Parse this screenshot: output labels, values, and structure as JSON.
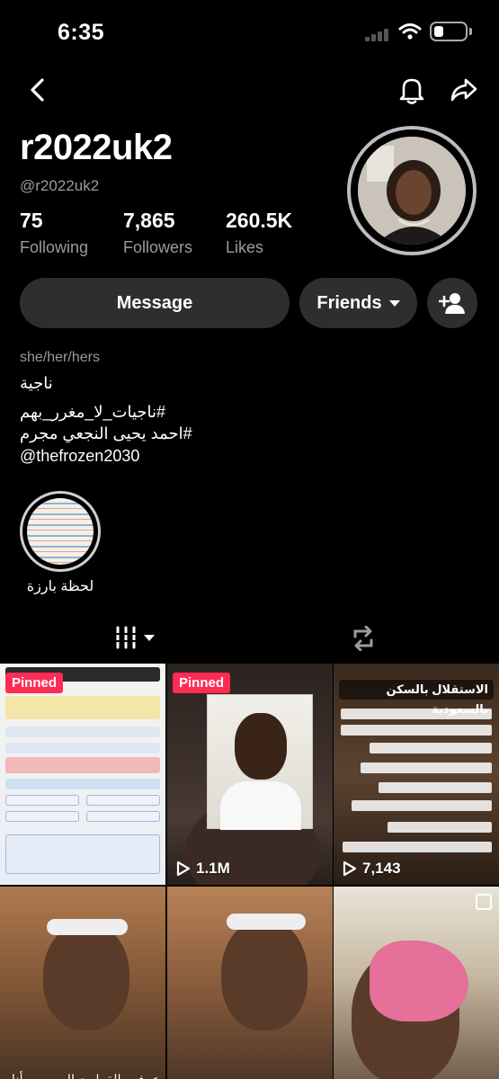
{
  "status_bar": {
    "time": "6:35"
  },
  "profile": {
    "username": "r2022uk2",
    "handle": "@r2022uk2",
    "stats": [
      {
        "value": "75",
        "label": "Following"
      },
      {
        "value": "7,865",
        "label": "Followers"
      },
      {
        "value": "260.5K",
        "label": "Likes"
      }
    ],
    "pronouns": "she/her/hers",
    "bio": [
      "ناجية",
      "#ناجيات_لا_مغرر_بهم",
      "#احمد يحيى النجعي مجرم",
      "@thefrozen2030"
    ]
  },
  "actions": {
    "message": "Message",
    "friends": "Friends"
  },
  "highlight": {
    "label": "لحظة بارزة"
  },
  "grid": {
    "tiles": [
      {
        "pinned": "Pinned",
        "views": ""
      },
      {
        "pinned": "Pinned",
        "views": "1.1M"
      },
      {
        "pinned": "",
        "views": "7,143",
        "heading": "الاستقلال بالسكن بالسعودية"
      },
      {
        "pinned": "",
        "views": "",
        "caption": "عرفت القولون العصبي وأنا عمري"
      },
      {
        "pinned": "",
        "views": ""
      },
      {
        "pinned": "",
        "views": ""
      }
    ]
  },
  "icons": [
    "back-icon",
    "bell-icon",
    "share-icon",
    "add-user-icon",
    "grid-icon",
    "repost-icon",
    "play-icon"
  ]
}
